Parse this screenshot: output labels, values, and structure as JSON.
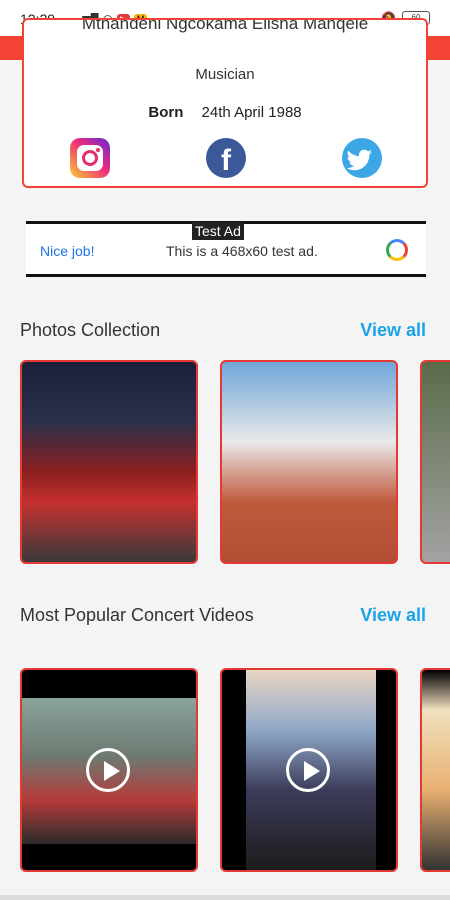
{
  "status_bar": {
    "time": "12:29",
    "battery": "60"
  },
  "profile": {
    "name": "Mthandeni Ngcokama Elisha Manqele",
    "occupation": "Musician",
    "born_label": "Born",
    "born_value": "24th April 1988",
    "social": [
      {
        "name": "Instagram",
        "icon": "instagram-icon"
      },
      {
        "name": "Facebook",
        "icon": "facebook-icon"
      },
      {
        "name": "Twitter",
        "icon": "twitter-icon"
      }
    ]
  },
  "ad": {
    "label": "Test Ad",
    "nice": "Nice job!",
    "text": "This is a 468x60 test ad."
  },
  "photos": {
    "title": "Photos Collection",
    "view_all": "View all"
  },
  "videos": {
    "title": "Most Popular Concert Videos",
    "view_all": "View all"
  },
  "colors": {
    "accent": "#f44336",
    "link": "#1aa3e8"
  }
}
